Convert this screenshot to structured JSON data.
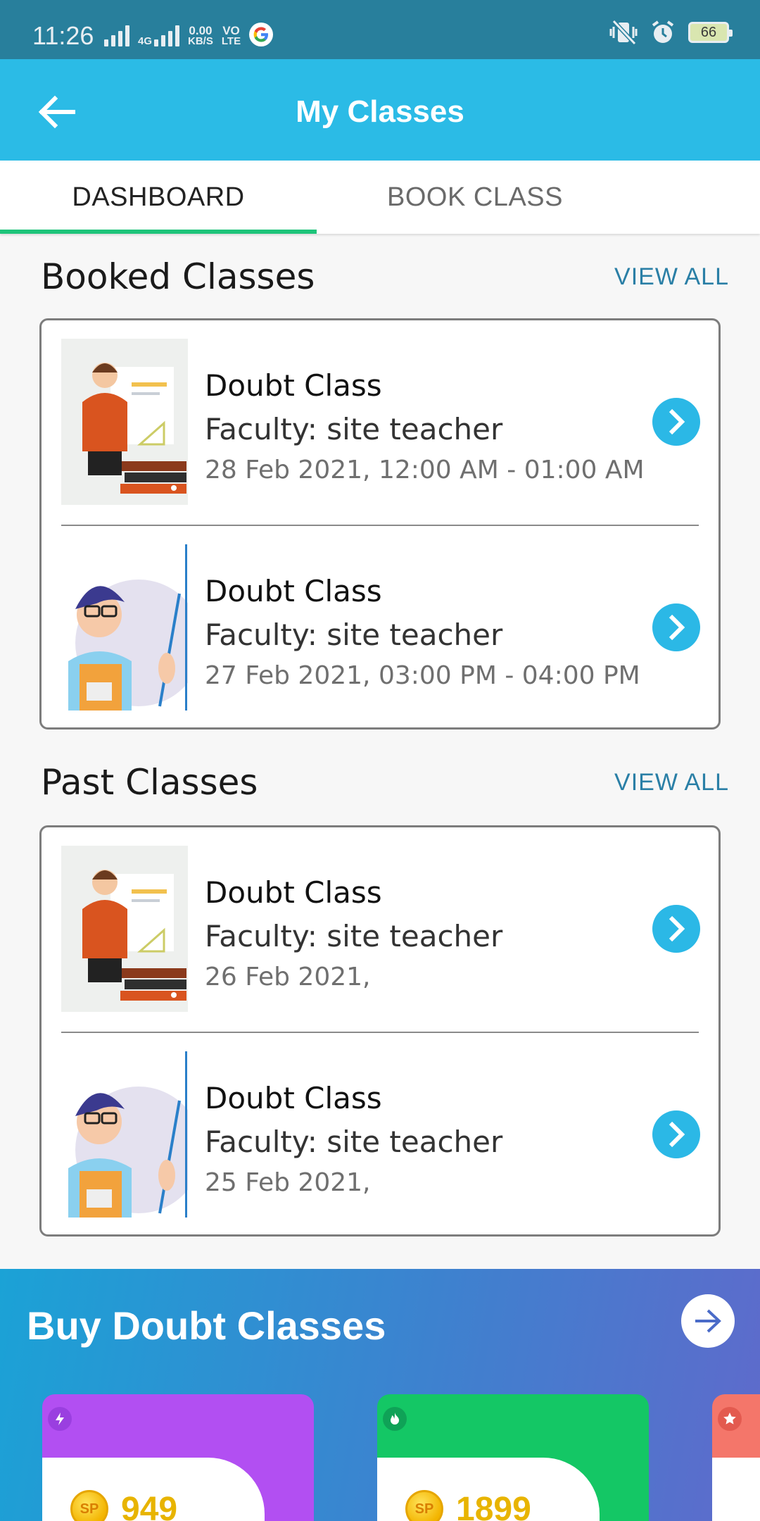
{
  "status_bar": {
    "time": "11:26",
    "network_type": "4G",
    "speed_value": "0.00",
    "speed_unit": "KB/S",
    "volte_top": "VO",
    "volte_bottom": "LTE",
    "battery": "66"
  },
  "app_bar": {
    "title": "My Classes"
  },
  "tabs": [
    {
      "label": "DASHBOARD",
      "active": true
    },
    {
      "label": "BOOK CLASS",
      "active": false
    }
  ],
  "booked": {
    "title": "Booked Classes",
    "view_all": "VIEW ALL",
    "items": [
      {
        "title": "Doubt Class",
        "faculty": "Faculty: site teacher",
        "date": "28 Feb 2021, 12:00 AM - 01:00 AM",
        "image": "teacher-board-illustration"
      },
      {
        "title": "Doubt Class",
        "faculty": "Faculty: site teacher",
        "date": "27 Feb 2021, 03:00 PM - 04:00 PM",
        "image": "teacher-pointer-illustration"
      }
    ]
  },
  "past": {
    "title": "Past Classes",
    "view_all": "VIEW ALL",
    "items": [
      {
        "title": "Doubt Class",
        "faculty": "Faculty: site teacher",
        "date": "26 Feb 2021,",
        "image": "teacher-board-illustration"
      },
      {
        "title": "Doubt Class",
        "faculty": "Faculty: site teacher",
        "date": "25 Feb 2021,",
        "image": "teacher-pointer-illustration"
      }
    ]
  },
  "promo": {
    "title": "Buy Doubt Classes",
    "packages": [
      {
        "price": "949",
        "coin_label": "SP",
        "color": "#b24ff2",
        "badge_color": "#9a3fe0",
        "badge_icon": "lightning-icon"
      },
      {
        "price": "1899",
        "coin_label": "SP",
        "color": "#14c765",
        "badge_color": "#0fa257",
        "badge_icon": "flame-icon"
      },
      {
        "price": "",
        "coin_label": "",
        "color": "#f4766a",
        "badge_color": "#e35a4f",
        "badge_icon": "star-icon"
      }
    ]
  },
  "colors": {
    "status_bar": "#287f9c",
    "app_bar": "#2bbbe6",
    "tab_indicator": "#1ec47a",
    "view_all": "#2a7fa6",
    "go_button": "#2bb8e6"
  }
}
